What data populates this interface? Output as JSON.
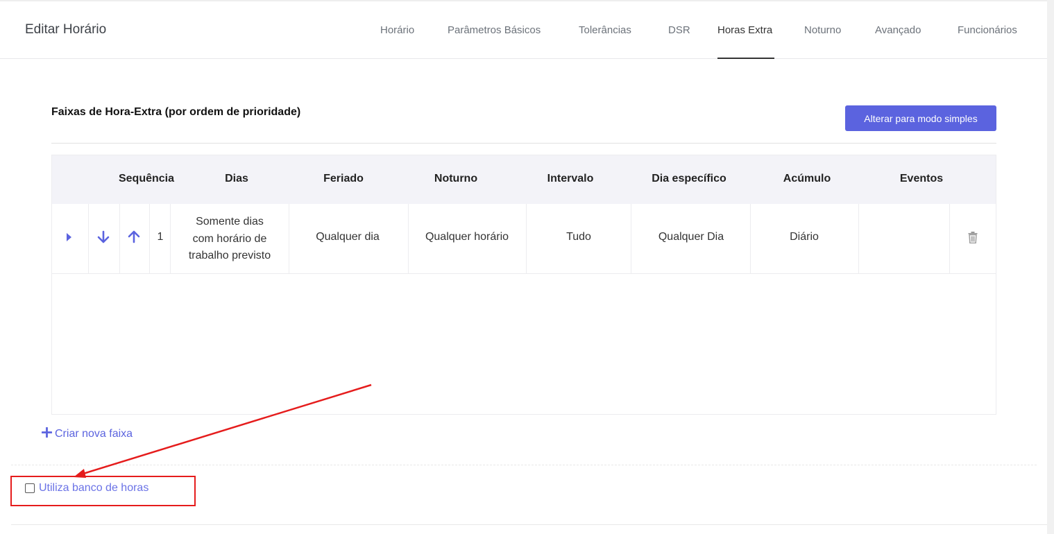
{
  "header": {
    "title": "Editar Horário",
    "tabs": [
      {
        "label": "Horário"
      },
      {
        "label": "Parâmetros Básicos"
      },
      {
        "label": "Tolerâncias"
      },
      {
        "label": "DSR"
      },
      {
        "label": "Horas Extra",
        "active": true
      },
      {
        "label": "Noturno"
      },
      {
        "label": "Avançado"
      },
      {
        "label": "Funcionários"
      }
    ]
  },
  "section": {
    "title": "Faixas de Hora-Extra (por ordem de prioridade)",
    "mode_button": "Alterar para modo simples"
  },
  "table": {
    "columns": [
      "Sequência",
      "Dias",
      "Feriado",
      "Noturno",
      "Intervalo",
      "Dia específico",
      "Acúmulo",
      "Eventos"
    ],
    "rows": [
      {
        "sequence": "1",
        "dias_line1": "Somente dias",
        "dias_line2": "com horário de",
        "dias_line3": "trabalho previsto",
        "feriado": "Qualquer dia",
        "noturno": "Qualquer horário",
        "intervalo": "Tudo",
        "dia_especifico": "Qualquer Dia",
        "acumulo": "Diário",
        "eventos": ""
      }
    ]
  },
  "create_link": "Criar nova faixa",
  "bank_hours": {
    "label": "Utiliza banco de horas",
    "checked": false
  },
  "colors": {
    "accent": "#5b63df",
    "annotation": "#e51c1c"
  },
  "icons": [
    "caret-right-icon",
    "arrow-down-icon",
    "arrow-up-icon",
    "trash-icon",
    "plus-icon"
  ]
}
